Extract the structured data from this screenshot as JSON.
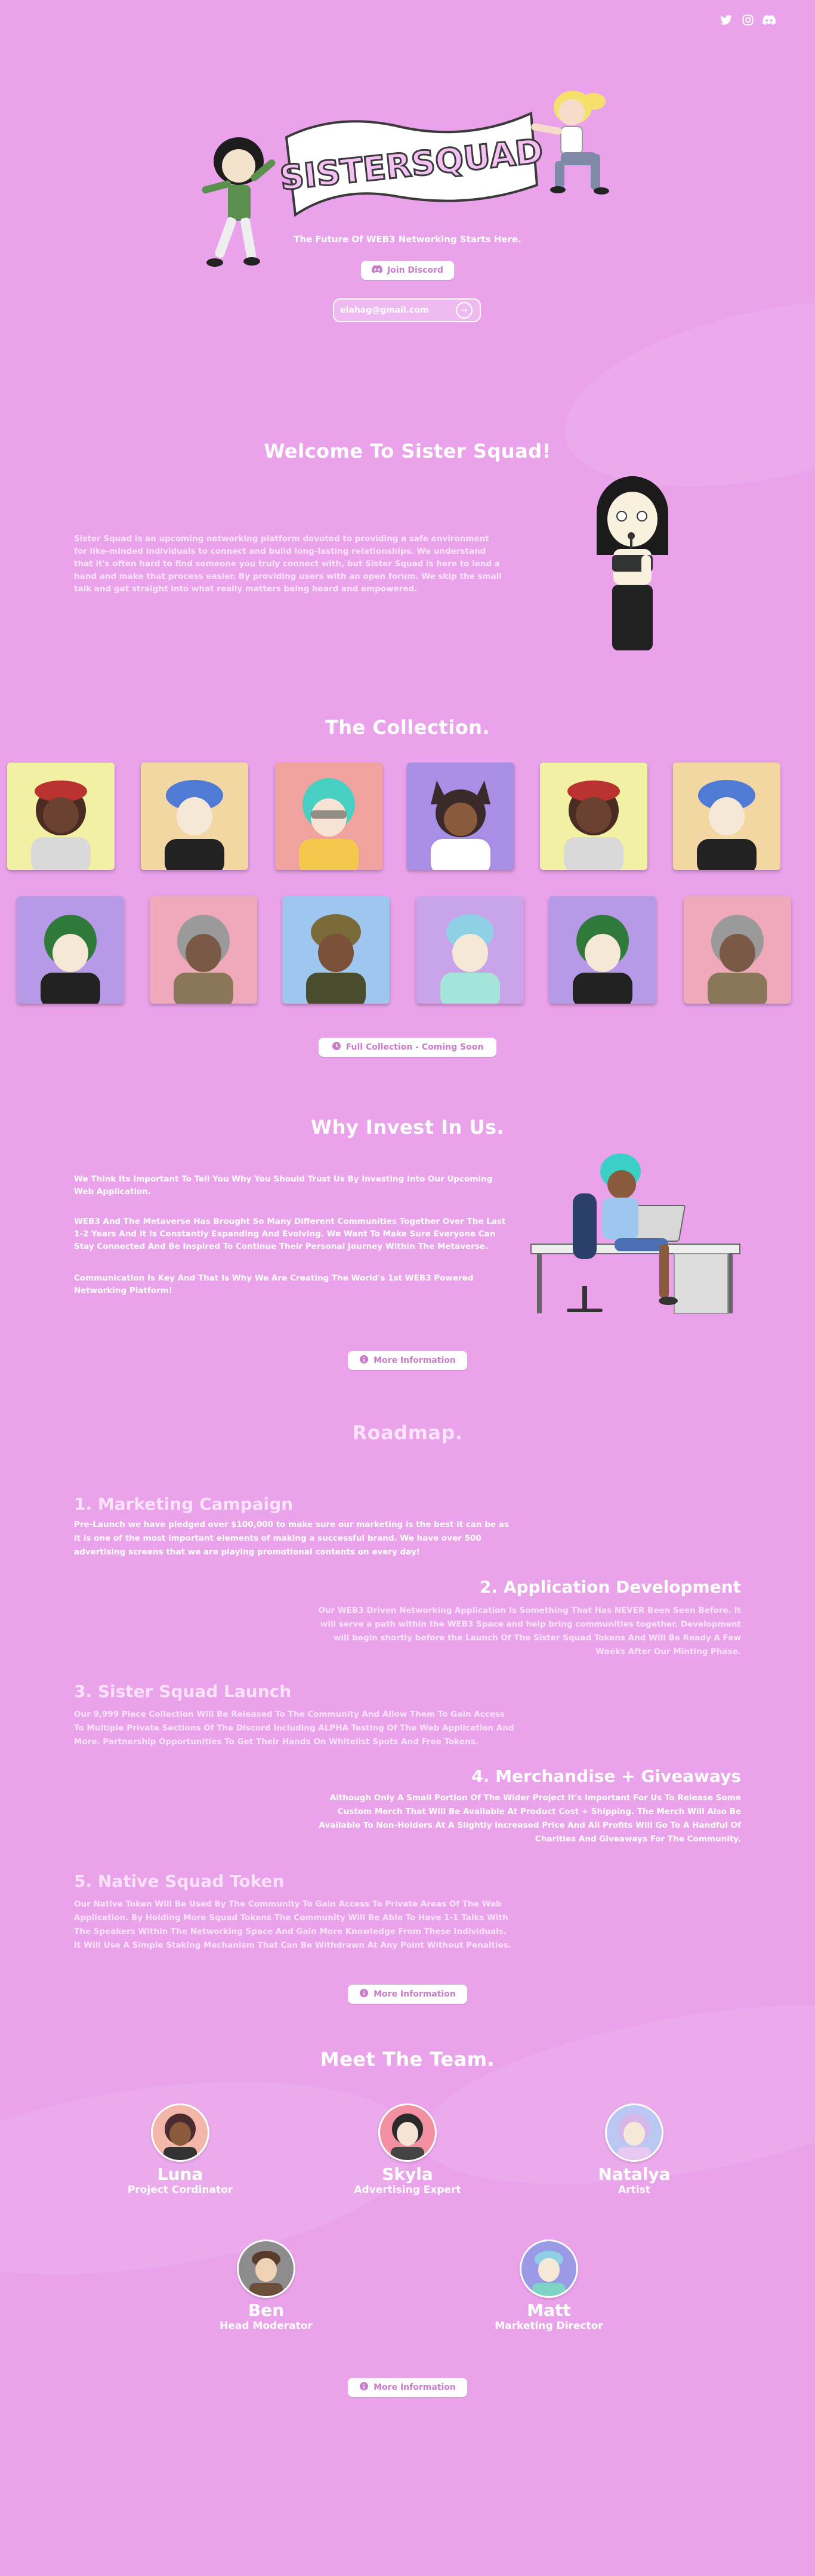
{
  "social": {
    "icons": [
      "twitter-icon",
      "instagram-icon",
      "discord-icon"
    ]
  },
  "hero": {
    "logo_text": "SISTERSQUAD",
    "tagline": "The Future Of WEB3 Networking Starts Here.",
    "join_label": "Join Discord",
    "email_value": "elahag@gmail.com",
    "submit_arrow": "→"
  },
  "welcome": {
    "title": "Welcome To Sister Squad!",
    "body": "Sister Squad is an upcoming networking platform devoted to providing a safe environment for like-minded individuals to connect and build long-lasting relationships. We understand that it's often hard to find someone you truly connect with, but Sister Squad is here to lend a hand and make that process easier. By providing users with an open forum. We skip the small talk and get straight into what really matters being heard and empowered."
  },
  "collection": {
    "title": "The Collection.",
    "button_label": "Full Collection - Coming Soon"
  },
  "invest": {
    "title": "Why Invest In Us.",
    "p1": "We Think Its Important To Tell You Why You Should Trust Us By Investing Into Our Upcoming Web Application.",
    "p2": "WEB3 And The Metaverse Has Brought So Many Different Communities Together Over The Last 1-2 Years And It Is Constantly Expanding And Evolving. We Want To Make Sure Everyone Can Stay Connected And Be Inspired To Continue Their Personal Journey Within The Metaverse.",
    "p3": "Communication Is Key And That Is Why We Are Creating The World's 1st WEB3 Powered Networking Platform!",
    "button_label": "More Information"
  },
  "roadmap": {
    "title": "Roadmap.",
    "items": [
      {
        "title": "1. Marketing Campaign",
        "text": "Pre-Launch we have pledged over $100,000 to make sure our marketing is the best it can be as it is one of the most important elements of making a successful brand. We have over 500 advertising screens that we are playing promotional contents on every day!"
      },
      {
        "title": "2. Application Development",
        "text": "Our WEB3 Driven Networking Application Is Something That Has NEVER Been Seen Before. It will serve a path within the WEB3 Space and help bring communities together. Development will begin shortly before the Launch Of The Sister Squad Tokens And Will Be Ready A Few Weeks After Our Minting Phase."
      },
      {
        "title": "3. Sister Squad Launch",
        "text": "Our 9,999 Piece Collection Will Be Released To The Community And Allow Them To Gain Access To Multiple Private Sections Of The Discord Including ALPHA Testing Of The Web Application And More. Partnership Opportunities To Get Their Hands On Whitelist Spots And Free Tokens."
      },
      {
        "title": "4. Merchandise + Giveaways",
        "text": "Although Only A Small Portion Of The Wider Project It's Important For Us To Release Some Custom Merch That Will Be Available At Product Cost + Shipping. The Merch Will Also Be Available To Non-Holders At A Slightly Increased Price And All Profits Will Go To A Handful Of Charities And Giveaways For The Community."
      },
      {
        "title": "5. Native Squad Token",
        "text": "Our Native Token Will Be Used By The Community To Gain Access To Private Areas Of The Web Application. By Holding More Squad Tokens The Community Will Be Able To Have 1-1 Talks With The Speakers Within The Networking Space And Gain More Knowledge From These Individuals. It Will Use A Simple Staking Mechanism That Can Be Withdrawn At Any Point Without Penalties."
      }
    ],
    "button_label": "More Information"
  },
  "team": {
    "title": "Meet The Team.",
    "members": [
      {
        "name": "Luna",
        "role": "Project Cordinator"
      },
      {
        "name": "Skyla",
        "role": "Advertising Expert"
      },
      {
        "name": "Natalya",
        "role": "Artist"
      },
      {
        "name": "Ben",
        "role": "Head Moderator"
      },
      {
        "name": "Matt",
        "role": "Marketing Director"
      }
    ],
    "button_label": "More Information"
  },
  "colors": {
    "background": "#eaa3eb",
    "accent": "#c97cc9",
    "white": "#ffffff"
  }
}
